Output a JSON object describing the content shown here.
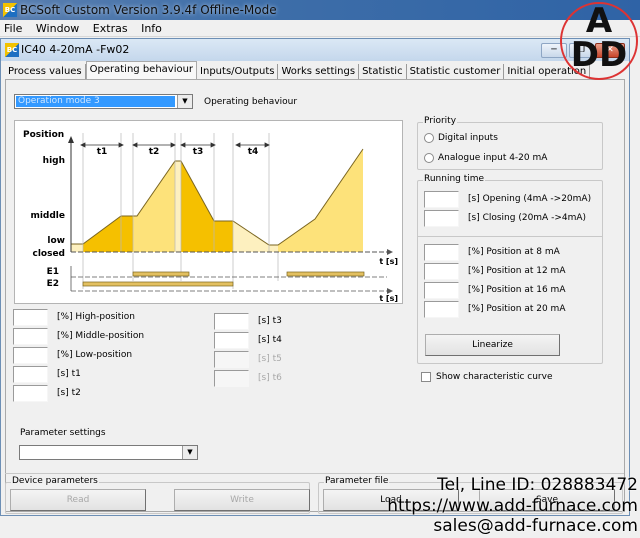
{
  "app": {
    "title": "BCSoft Custom Version 3.9.4f Offline-Mode",
    "logo": "BC",
    "menu": [
      "File",
      "Window",
      "Extras",
      "Info"
    ]
  },
  "child_window": {
    "title": "IC40 4-20mA -Fw02",
    "logo": "BC",
    "minimize_icon": "minimize-icon",
    "restore_icon": "restore-icon",
    "close_icon": "close-icon"
  },
  "tabs": [
    {
      "label": "Process values",
      "active": false
    },
    {
      "label": "Operating behaviour",
      "active": true
    },
    {
      "label": "Inputs/Outputs",
      "active": false
    },
    {
      "label": "Works settings",
      "active": false
    },
    {
      "label": "Statistic",
      "active": false
    },
    {
      "label": "Statistic customer",
      "active": false
    },
    {
      "label": "Initial operation",
      "active": false
    }
  ],
  "operating_mode": {
    "selected": "Operation mode 3",
    "label": "Operating behaviour"
  },
  "diagram": {
    "y_title": "Position",
    "y_levels": [
      "high",
      "middle",
      "low",
      "closed"
    ],
    "intervals": [
      "t1",
      "t2",
      "t3",
      "t4"
    ],
    "signals": [
      "E1",
      "E2"
    ],
    "x_label_top": "t [s]",
    "x_label_bottom": "t [s]",
    "colors": {
      "dark": "#f5c000",
      "light": "#fde27a",
      "pale": "#fdf0bf",
      "outline": "#7a6520",
      "bar": "#e3c060"
    }
  },
  "left_fields": [
    {
      "label": "[%] High-position",
      "value": "",
      "disabled": false
    },
    {
      "label": "[%] Middle-position",
      "value": "",
      "disabled": false
    },
    {
      "label": "[%] Low-position",
      "value": "",
      "disabled": false
    },
    {
      "label": "[s] t1",
      "value": "",
      "disabled": false
    },
    {
      "label": "[s] t2",
      "value": "",
      "disabled": false
    }
  ],
  "mid_fields": [
    {
      "label": "[s] t3",
      "value": "",
      "disabled": false
    },
    {
      "label": "[s] t4",
      "value": "",
      "disabled": false
    },
    {
      "label": "[s] t5",
      "value": "",
      "disabled": true
    },
    {
      "label": "[s] t6",
      "value": "",
      "disabled": true
    }
  ],
  "priority": {
    "title": "Priority",
    "options": [
      {
        "label": "Digital inputs",
        "checked": false
      },
      {
        "label": "Analogue input 4-20 mA",
        "checked": false
      }
    ]
  },
  "running_time": {
    "title": "Running time",
    "fields": [
      {
        "label": "[s] Opening (4mA ->20mA)",
        "value": ""
      },
      {
        "label": "[s] Closing (20mA ->4mA)",
        "value": ""
      }
    ],
    "positions": [
      {
        "label": "[%] Position at 8 mA",
        "value": ""
      },
      {
        "label": "[%] Position at 12 mA",
        "value": ""
      },
      {
        "label": "[%] Position at 16 mA",
        "value": ""
      },
      {
        "label": "[%] Position at 20 mA",
        "value": ""
      }
    ],
    "linearize_label": "Linearize"
  },
  "show_curve": {
    "label": "Show characteristic curve",
    "checked": false
  },
  "parameter_settings": {
    "label": "Parameter settings",
    "selected": ""
  },
  "device_parameters": {
    "title": "Device parameters",
    "read_label": "Read",
    "write_label": "Write"
  },
  "parameter_file": {
    "title": "Parameter file",
    "load_label": "Load",
    "save_label": "Save"
  },
  "watermark": {
    "logo_top": "A",
    "logo_bottom": "DD",
    "line1": "Tel, Line ID: 028883472",
    "line2": "https://www.add-furnace.com",
    "line3": "sales@add-furnace.com"
  }
}
